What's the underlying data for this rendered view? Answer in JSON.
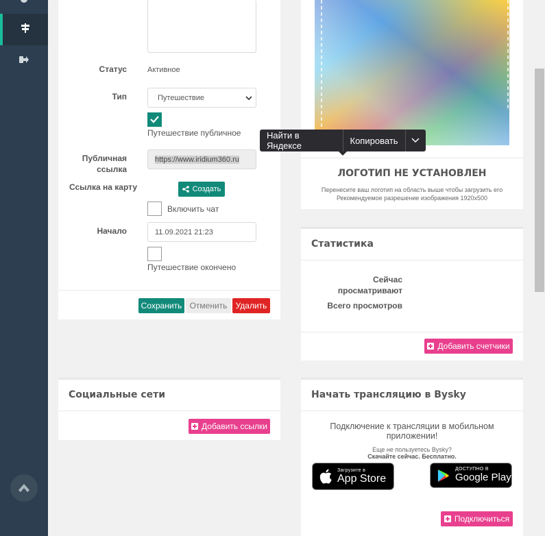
{
  "sidebar": {
    "items": [
      {
        "icon": "settings-icon",
        "label": ""
      },
      {
        "icon": "signpost-icon",
        "label": ""
      },
      {
        "icon": "sign-out-icon",
        "label": ""
      }
    ]
  },
  "trip_form": {
    "status_label": "Статус",
    "status_value": "Активное",
    "type_label": "Тип",
    "type_value": "Путешествие",
    "public_checkbox_label": "Путешествие публичное",
    "public_checked": true,
    "public_link_label": "Публичная ссылка",
    "public_link_value": "https://www.iridium360.ru",
    "map_link_label": "Ссылка на карту",
    "create_button": "Создать",
    "chat_checkbox_label": "Включить чат",
    "start_label": "Начало",
    "start_value": "11.09.2021 21:23",
    "finished_checkbox_label": "Путешествие окончено",
    "save_button": "Сохранить",
    "cancel_button": "Отменить",
    "delete_button": "Удалить"
  },
  "context_menu": {
    "search_label": "Найти в Яндексе",
    "copy_label": "Копировать"
  },
  "logo_panel": {
    "title": "ЛОГОТИП НЕ УСТАНОВЛЕН",
    "hint_line1": "Перенесите ваш логотип на область выше чтобы загрузить его",
    "hint_line2": "Рекомендуемое разрешение изображения 1920x500"
  },
  "stats_panel": {
    "title": "Статистика",
    "now_watching_label": "Сейчас просматривают",
    "total_views_label": "Всего просмотров",
    "add_counters_button": "Добавить счетчики"
  },
  "social_panel": {
    "title": "Социальные сети",
    "add_links_button": "Добавить ссылки"
  },
  "bysky_panel": {
    "title": "Начать трансляцию в Bysky",
    "description": "Подключение к трансляции в мобильном приложении!",
    "not_using": "Еще не пользуетесь Bysky?",
    "download_now": "Скачайте сейчас. Бесплатно.",
    "appstore_small": "Загрузите в",
    "appstore_big": "App Store",
    "googleplay_small": "ДОСТУПНО В",
    "googleplay_big": "Google Play",
    "connect_button": "Подключиться"
  },
  "colors": {
    "sidebar": "#2c3e50",
    "teal": "#128a7a",
    "red": "#e02424",
    "pink": "#e8408e"
  }
}
